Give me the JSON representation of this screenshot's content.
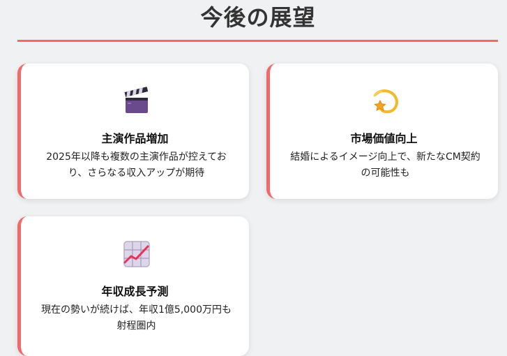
{
  "header": {
    "title": "今後の展望"
  },
  "cards": [
    {
      "icon": "clapperboard-icon",
      "title": "主演作品増加",
      "description": "2025年以降も複数の主演作品が控えており、さらなる収入アップが期待"
    },
    {
      "icon": "dizzy-star-icon",
      "title": "市場価値向上",
      "description": "結婚によるイメージ向上で、新たなCM契約の可能性も"
    },
    {
      "icon": "chart-increasing-icon",
      "title": "年収成長予測",
      "description": "現在の勢いが続けば、年収1億5,000万円も射程圏内"
    }
  ],
  "colors": {
    "accent": "#f06a6a",
    "background": "#f0f1f3",
    "card": "#ffffff"
  }
}
